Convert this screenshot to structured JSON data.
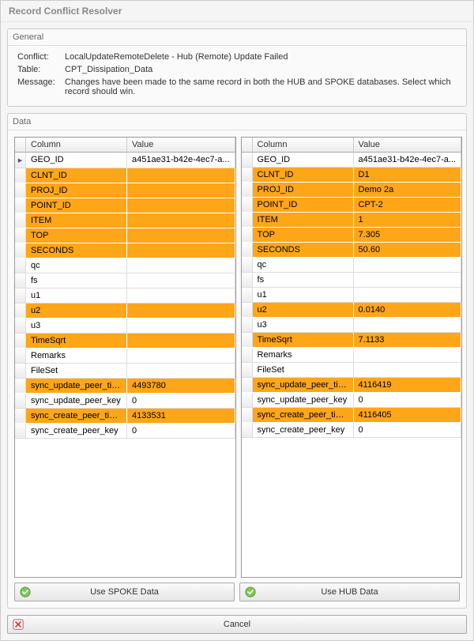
{
  "title": "Record Conflict Resolver",
  "general": {
    "legend": "General",
    "conflict_label": "Conflict:",
    "conflict_value": "LocalUpdateRemoteDelete - Hub (Remote) Update Failed",
    "table_label": "Table:",
    "table_value": "CPT_Dissipation_Data",
    "message_label": "Message:",
    "message_value": "Changes have been made to the same record in both the HUB and SPOKE databases. Select which record should win."
  },
  "data": {
    "legend": "Data",
    "headers": {
      "column": "Column",
      "value": "Value"
    },
    "left": [
      {
        "col": "GEO_ID",
        "val": "a451ae31-b42e-4ec7-a...",
        "hl": false,
        "current": true
      },
      {
        "col": "CLNT_ID",
        "val": "",
        "hl": true
      },
      {
        "col": "PROJ_ID",
        "val": "",
        "hl": true
      },
      {
        "col": "POINT_ID",
        "val": "",
        "hl": true
      },
      {
        "col": "ITEM",
        "val": "",
        "hl": true
      },
      {
        "col": "TOP",
        "val": "",
        "hl": true
      },
      {
        "col": "SECONDS",
        "val": "",
        "hl": true
      },
      {
        "col": "qc",
        "val": "",
        "hl": false
      },
      {
        "col": "fs",
        "val": "",
        "hl": false
      },
      {
        "col": "u1",
        "val": "",
        "hl": false
      },
      {
        "col": "u2",
        "val": "",
        "hl": true
      },
      {
        "col": "u3",
        "val": "",
        "hl": false
      },
      {
        "col": "TimeSqrt",
        "val": "",
        "hl": true
      },
      {
        "col": "Remarks",
        "val": "",
        "hl": false
      },
      {
        "col": "FileSet",
        "val": "",
        "hl": false
      },
      {
        "col": "sync_update_peer_tim...",
        "val": "4493780",
        "hl": true
      },
      {
        "col": "sync_update_peer_key",
        "val": "0",
        "hl": false
      },
      {
        "col": "sync_create_peer_time...",
        "val": "4133531",
        "hl": true
      },
      {
        "col": "sync_create_peer_key",
        "val": "0",
        "hl": false
      }
    ],
    "right": [
      {
        "col": "GEO_ID",
        "val": "a451ae31-b42e-4ec7-a...",
        "hl": false
      },
      {
        "col": "CLNT_ID",
        "val": "D1",
        "hl": true
      },
      {
        "col": "PROJ_ID",
        "val": "Demo 2a",
        "hl": true
      },
      {
        "col": "POINT_ID",
        "val": "CPT-2",
        "hl": true
      },
      {
        "col": "ITEM",
        "val": "1",
        "hl": true
      },
      {
        "col": "TOP",
        "val": "7.305",
        "hl": true
      },
      {
        "col": "SECONDS",
        "val": "50.60",
        "hl": true
      },
      {
        "col": "qc",
        "val": "",
        "hl": false
      },
      {
        "col": "fs",
        "val": "",
        "hl": false
      },
      {
        "col": "u1",
        "val": "",
        "hl": false
      },
      {
        "col": "u2",
        "val": "0.0140",
        "hl": true
      },
      {
        "col": "u3",
        "val": "",
        "hl": false
      },
      {
        "col": "TimeSqrt",
        "val": "7.1133",
        "hl": true
      },
      {
        "col": "Remarks",
        "val": "",
        "hl": false
      },
      {
        "col": "FileSet",
        "val": "",
        "hl": false
      },
      {
        "col": "sync_update_peer_tim...",
        "val": "4116419",
        "hl": true
      },
      {
        "col": "sync_update_peer_key",
        "val": "0",
        "hl": false
      },
      {
        "col": "sync_create_peer_time...",
        "val": "4116405",
        "hl": true
      },
      {
        "col": "sync_create_peer_key",
        "val": "0",
        "hl": false
      }
    ]
  },
  "buttons": {
    "use_spoke": "Use SPOKE Data",
    "use_hub": "Use HUB Data",
    "cancel": "Cancel"
  }
}
